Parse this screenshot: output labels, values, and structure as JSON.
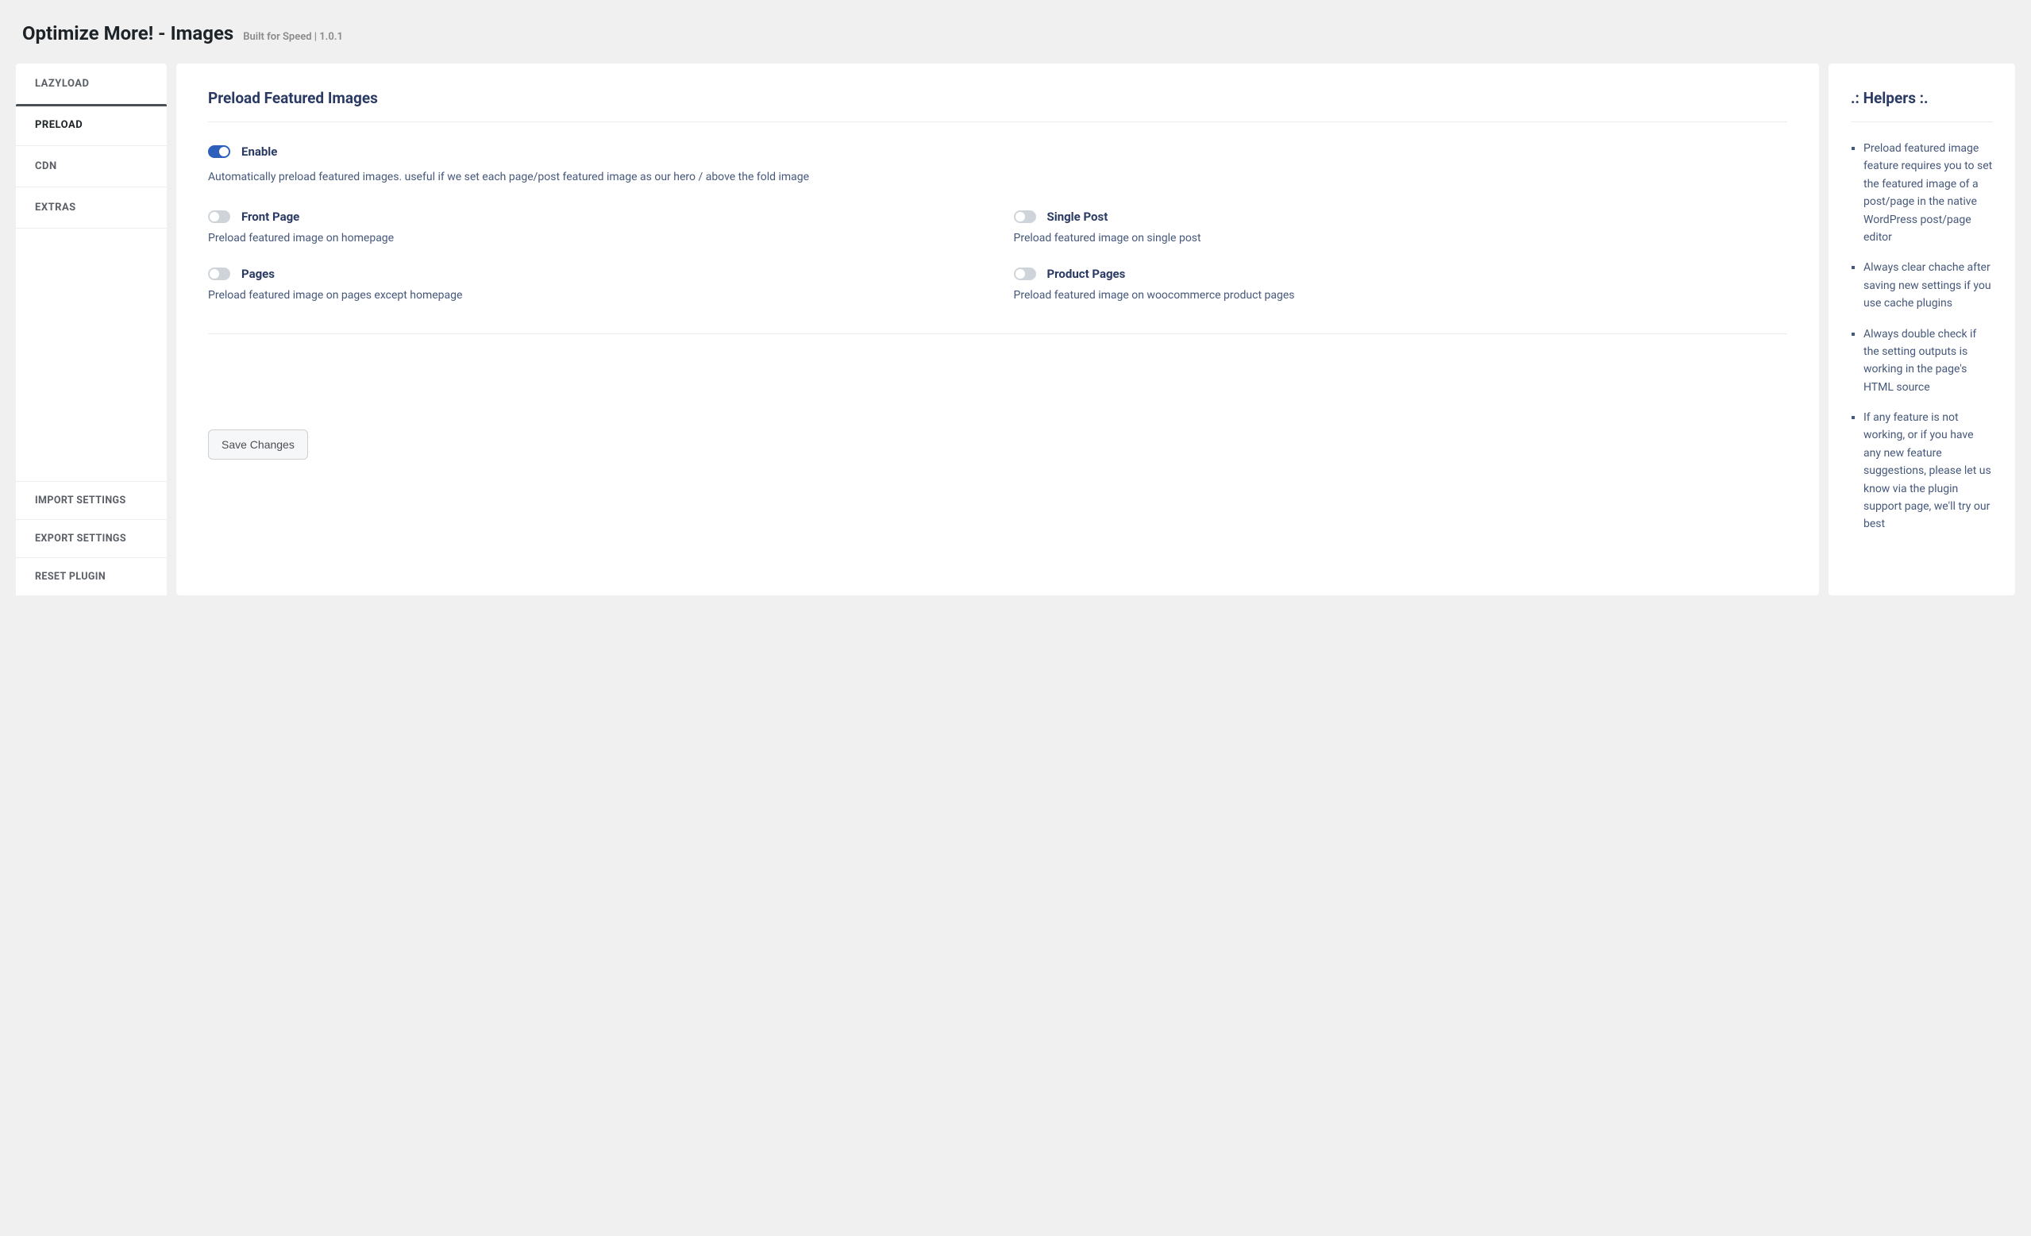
{
  "header": {
    "title": "Optimize More! - Images",
    "subtitle": "Built for Speed | 1.0.1"
  },
  "sidebar": {
    "tabs": [
      {
        "label": "LAZYLOAD",
        "active": false
      },
      {
        "label": "PRELOAD",
        "active": true
      },
      {
        "label": "CDN",
        "active": false
      },
      {
        "label": "EXTRAS",
        "active": false
      }
    ],
    "actions": [
      {
        "label": "IMPORT SETTINGS"
      },
      {
        "label": "EXPORT SETTINGS"
      },
      {
        "label": "RESET PLUGIN"
      }
    ]
  },
  "main": {
    "section_title": "Preload Featured Images",
    "enable": {
      "label": "Enable",
      "on": true,
      "description": "Automatically preload featured images. useful if we set each page/post featured image as our hero / above the fold image"
    },
    "options": [
      {
        "label": "Front Page",
        "on": false,
        "description": "Preload featured image on homepage"
      },
      {
        "label": "Single Post",
        "on": false,
        "description": "Preload featured image on single post"
      },
      {
        "label": "Pages",
        "on": false,
        "description": "Preload featured image on pages except homepage"
      },
      {
        "label": "Product Pages",
        "on": false,
        "description": "Preload featured image on woocommerce product pages"
      }
    ],
    "save_label": "Save Changes"
  },
  "helpers": {
    "title": ".: Helpers :.",
    "items": [
      "Preload featured image feature requires you to set the featured image of a post/page in the native WordPress post/page editor",
      "Always clear chache after saving new settings if you use cache plugins",
      "Always double check if the setting outputs is working in the page's HTML source",
      "If any feature is not working, or if you have any new feature suggestions, please let us know via the plugin support page, we'll try our best"
    ]
  }
}
